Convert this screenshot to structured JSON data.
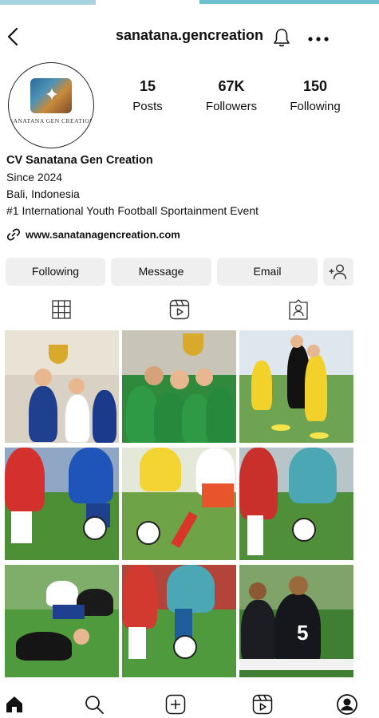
{
  "header": {
    "username": "sanatana.gencreation"
  },
  "profile": {
    "avatar_text": "SANATANA GEN CREATION",
    "stats": [
      {
        "value": "15",
        "label": "Posts"
      },
      {
        "value": "67K",
        "label": "Followers"
      },
      {
        "value": "150",
        "label": "Following"
      }
    ],
    "name": "CV Sanatana Gen Creation",
    "bio_lines": [
      "Since 2024",
      "Bali, Indonesia",
      "#1 International Youth Football Sportainment Event"
    ],
    "website": "www.sanatanagencreation.com"
  },
  "actions": {
    "following": "Following",
    "message": "Message",
    "email": "Email"
  },
  "tabs": [
    "grid-icon",
    "reels-icon",
    "tagged-icon"
  ],
  "posts": [
    {
      "name": "post-trophy-celebration",
      "sky": "#e9e3d6",
      "field": "#d9d2c4"
    },
    {
      "name": "post-team-trophy",
      "sky": "#c9c4b8",
      "field": "#2f8a3d"
    },
    {
      "name": "post-training-drill",
      "sky": "#dfe7ee",
      "field": "#6ea352"
    },
    {
      "name": "post-match-red-blue",
      "sky": "#8fa7c4",
      "field": "#4d8f35"
    },
    {
      "name": "post-match-yellow-orange",
      "sky": "#e4e8d8",
      "field": "#6ea347"
    },
    {
      "name": "post-match-red-teal",
      "sky": "#b7c4c8",
      "field": "#4f8f3a"
    },
    {
      "name": "post-tackle",
      "sky": "#7fae6a",
      "field": "#4f9a3c"
    },
    {
      "name": "post-dribble",
      "sky": "#b4443a",
      "field": "#4e9a3d"
    },
    {
      "name": "post-team-bench",
      "sky": "#7fa368",
      "field": "#3f7f33"
    }
  ],
  "bottom_nav": [
    "home-icon",
    "search-icon",
    "create-icon",
    "reels-icon",
    "profile-icon"
  ]
}
